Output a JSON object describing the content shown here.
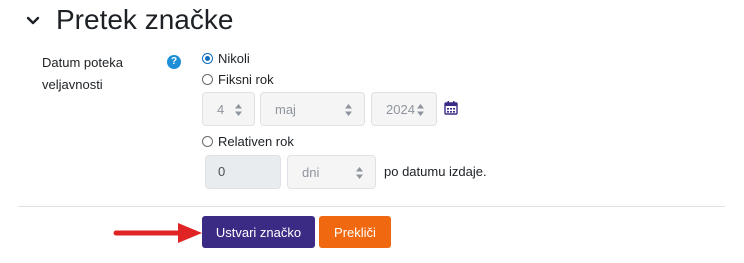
{
  "section": {
    "title": "Pretek značke",
    "toggle_icon": "chevron-down-icon"
  },
  "field": {
    "label": "Datum poteka veljavnosti",
    "help_icon": "question-circle-icon",
    "help_glyph": "?"
  },
  "options": {
    "never": {
      "label": "Nikoli",
      "checked": true
    },
    "fixed": {
      "label": "Fiksni rok",
      "checked": false
    },
    "relative": {
      "label": "Relativen rok",
      "checked": false
    }
  },
  "fixed_date": {
    "day": "4",
    "month": "maj",
    "year": "2024",
    "calendar_icon": "calendar-icon"
  },
  "relative_period": {
    "value": "0",
    "unit": "dni",
    "suffix": "po datumu izdaje."
  },
  "buttons": {
    "submit": "Ustvari značko",
    "cancel": "Prekliči"
  },
  "colors": {
    "primary": "#3c2b85",
    "cancel": "#f0680f",
    "annotation_arrow": "#e02424",
    "radio_checked": "#0f6cbf"
  }
}
